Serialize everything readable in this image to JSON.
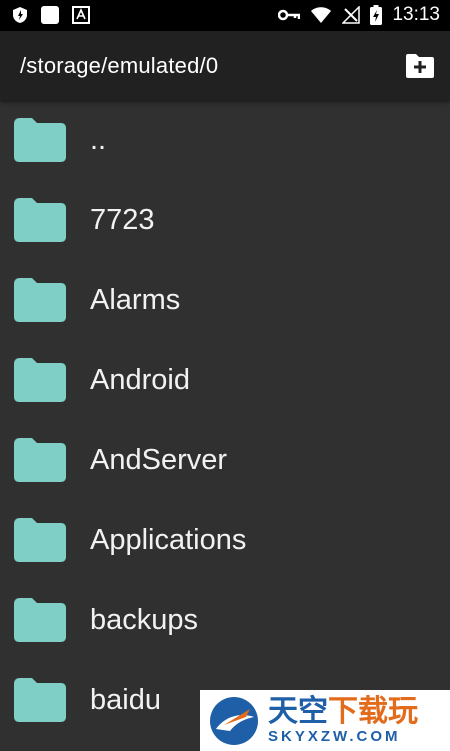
{
  "status_bar": {
    "time": "13:13",
    "icons": [
      "shield-icon",
      "square-icon",
      "font-icon",
      "key-icon",
      "wifi-icon",
      "no-signal-icon",
      "battery-charging-icon"
    ]
  },
  "app_bar": {
    "path": "/storage/emulated/0",
    "new_folder_icon": "new-folder-icon"
  },
  "colors": {
    "folder": "#7fcfc6",
    "background": "#303030",
    "app_bar": "#212121"
  },
  "files": [
    {
      "name": ".."
    },
    {
      "name": "7723"
    },
    {
      "name": "Alarms"
    },
    {
      "name": "Android"
    },
    {
      "name": "AndServer"
    },
    {
      "name": "Applications"
    },
    {
      "name": "backups"
    },
    {
      "name": "baidu"
    }
  ],
  "watermark": {
    "title_part1": "天空",
    "title_part2": "下载玩",
    "subtitle": "SKYXZW.COM"
  }
}
